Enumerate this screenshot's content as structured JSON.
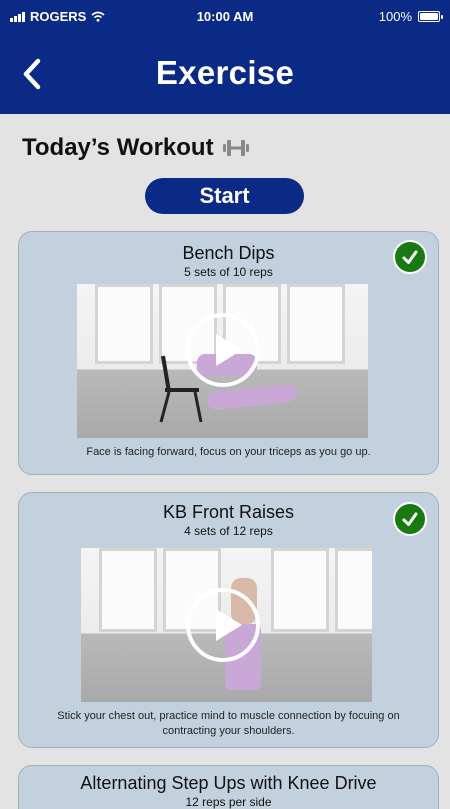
{
  "status": {
    "carrier": "ROGERS",
    "time": "10:00 AM",
    "battery": "100%"
  },
  "header": {
    "title": "Exercise"
  },
  "section": {
    "title": "Today’s Workout",
    "icon": "dumbbell-icon"
  },
  "start_button": {
    "label": "Start"
  },
  "colors": {
    "primary": "#0b2a85",
    "card_bg": "#c3d1de",
    "check": "#1a7a12",
    "page_bg": "#e3e3e3"
  },
  "exercises": [
    {
      "name": "Bench Dips",
      "sets": "5 sets of 10 reps",
      "note": "Face is facing forward, focus on your triceps as you go up.",
      "completed": true
    },
    {
      "name": "KB Front Raises",
      "sets": "4 sets of 12 reps",
      "note": "Stick your chest out, practice mind to muscle connection by focuing on contracting your shoulders.",
      "completed": true
    },
    {
      "name": "Alternating Step Ups with Knee Drive",
      "sets": "12 reps per side",
      "note": "",
      "completed": false
    }
  ]
}
